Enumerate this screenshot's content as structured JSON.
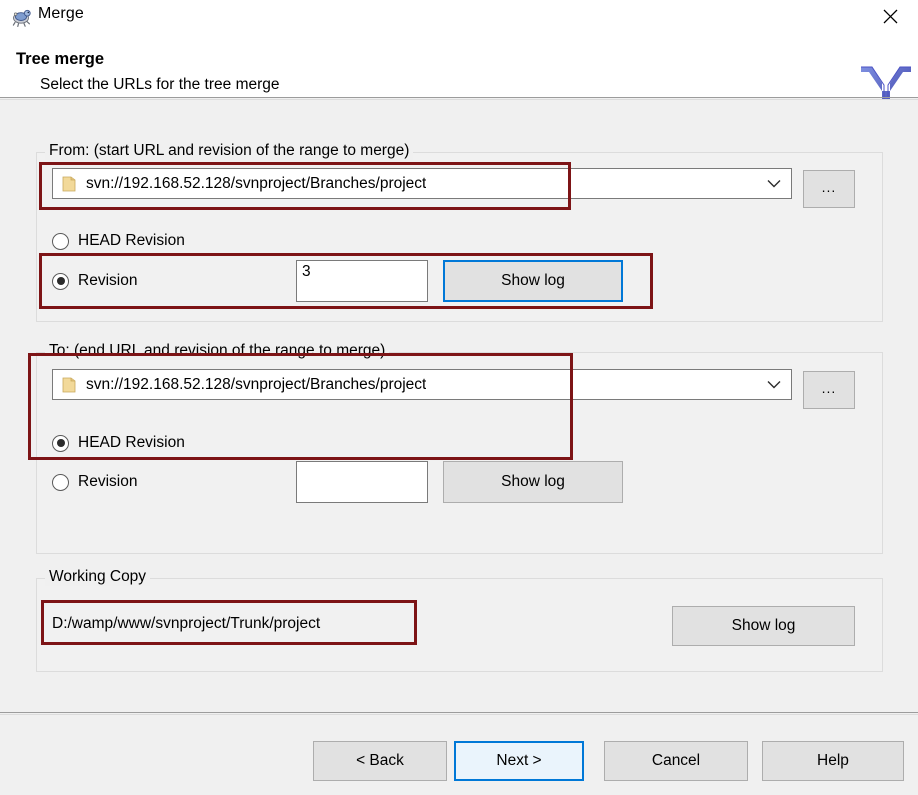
{
  "window": {
    "title": "Merge",
    "icon": "tortoise-svn-icon",
    "close_label": "✕"
  },
  "header": {
    "title": "Tree merge",
    "subtitle": "Select the URLs for the tree merge",
    "logo": "merge-arrow-icon"
  },
  "from_group": {
    "legend": "From: (start URL and revision of the range to merge)",
    "url": "svn://192.168.52.128/svnproject/Branches/project",
    "browse_label": "...",
    "head_revision_label": "HEAD Revision",
    "head_revision_selected": false,
    "revision_label": "Revision",
    "revision_selected": true,
    "revision_value": "3",
    "show_log_label": "Show log"
  },
  "to_group": {
    "legend": "To: (end URL and revision of the range to merge)",
    "url": "svn://192.168.52.128/svnproject/Branches/project",
    "browse_label": "...",
    "head_revision_label": "HEAD Revision",
    "head_revision_selected": true,
    "revision_label": "Revision",
    "revision_selected": false,
    "revision_value": "",
    "show_log_label": "Show log"
  },
  "working_copy_group": {
    "legend": "Working Copy",
    "path": "D:/wamp/www/svnproject/Trunk/project",
    "show_log_label": "Show log"
  },
  "footer": {
    "back_label": "< Back",
    "next_label": "Next >",
    "cancel_label": "Cancel",
    "help_label": "Help"
  },
  "colors": {
    "annotation": "#7d1416",
    "accent": "#0078d7",
    "dialog_bg": "#f0f0f0",
    "panel_bg": "#f1f1f1",
    "button_bg": "#e1e1e1",
    "default_button_bg": "#eaf4fc"
  }
}
